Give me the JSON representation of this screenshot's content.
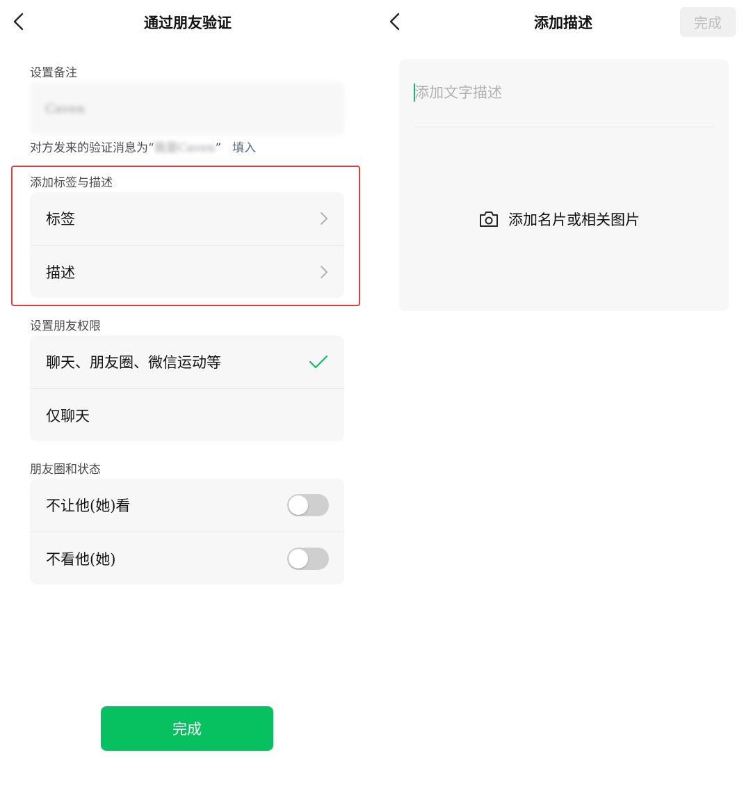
{
  "left": {
    "nav": {
      "title": "通过朋友验证"
    },
    "remark": {
      "section_label": "设置备注",
      "input_value": "Caven",
      "hint_prefix": "对方发来的验证消息为“",
      "hint_message": "我是Caven",
      "hint_suffix": "”",
      "fill_link": "填入"
    },
    "tags_section": {
      "label": "添加标签与描述",
      "items": [
        {
          "label": "标签"
        },
        {
          "label": "描述"
        }
      ]
    },
    "permissions": {
      "label": "设置朋友权限",
      "options": [
        {
          "label": "聊天、朋友圈、微信运动等",
          "selected": true
        },
        {
          "label": "仅聊天",
          "selected": false
        }
      ]
    },
    "moments": {
      "label": "朋友圈和状态",
      "items": [
        {
          "label": "不让他(她)看",
          "on": false
        },
        {
          "label": "不看他(她)",
          "on": false
        }
      ]
    },
    "done_button": "完成",
    "colors": {
      "accent": "#07c160",
      "link": "#576b95",
      "highlight": "#e23b3b"
    }
  },
  "right": {
    "nav": {
      "title": "添加描述",
      "done_button": "完成"
    },
    "description": {
      "placeholder": "添加文字描述",
      "add_photo_label": "添加名片或相关图片"
    }
  }
}
